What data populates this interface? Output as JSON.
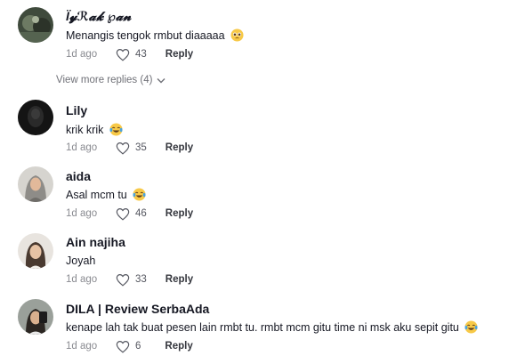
{
  "comments": [
    {
      "username": "Ï𝔂ℛ𝓪𝓴 ℘𝓪𝓷",
      "text": "Menangis tengok rmbut diaaaaa",
      "emoji": "pleading-face",
      "time": "1d ago",
      "likes": "43",
      "reply": "Reply"
    },
    {
      "username": "Lily",
      "text": "krik krik",
      "emoji": "tears-of-joy",
      "time": "1d ago",
      "likes": "35",
      "reply": "Reply"
    },
    {
      "username": "aida",
      "text": "Asal mcm tu",
      "emoji": "tears-of-joy",
      "time": "1d ago",
      "likes": "46",
      "reply": "Reply"
    },
    {
      "username": "Ain najiha",
      "text": "Joyah",
      "emoji": "",
      "time": "1d ago",
      "likes": "33",
      "reply": "Reply"
    },
    {
      "username": "DILA | Review SerbaAda",
      "text": "kenape lah tak buat pesen lain rmbt tu. rmbt mcm gitu time ni msk aku sepit gitu",
      "emoji": "tears-of-joy",
      "time": "1d ago",
      "likes": "6",
      "reply": "Reply"
    }
  ],
  "view_more_replies": "View more replies (4)",
  "icons": {
    "like": "heart-outline-icon",
    "expand": "chevron-down-icon"
  },
  "colors": {
    "text": "#161823",
    "meta": "#8a8b91",
    "reply": "#34363d",
    "background": "#ffffff"
  }
}
